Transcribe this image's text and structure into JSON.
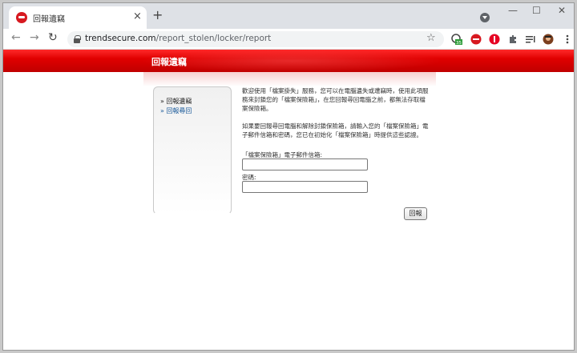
{
  "browser": {
    "tab_title": "回報遺竊",
    "tab_close": "×",
    "new_tab": "+",
    "minimize": "—",
    "maximize": "☐",
    "close_window": "✕",
    "back": "←",
    "forward": "→",
    "reload": "↻",
    "url_host": "trendsecure.com",
    "url_path": "/report_stolen/locker/report",
    "bookmark": "☆",
    "extensions": [
      {
        "name": "tracker-extension",
        "badge": "35"
      },
      {
        "name": "trend-micro-extension"
      },
      {
        "name": "pinterest-extension"
      },
      {
        "name": "extensions-puzzle"
      },
      {
        "name": "reading-list"
      },
      {
        "name": "profile-avatar"
      },
      {
        "name": "menu"
      }
    ]
  },
  "page": {
    "brand_title": "回報遺竊",
    "sidebar": {
      "items": [
        {
          "label": "回報遺竊",
          "current": true
        },
        {
          "label": "回報尋回",
          "current": false
        }
      ]
    },
    "intro_1": "歡迎使用「檔案掛失」服務，您可以在電腦遺失或遭竊時，使用此項服務來封鎖您的「檔案保險箱」，在您回報尋回電腦之前，都無法存取檔案保險箱。",
    "intro_2": "如果要回報尋回電腦和解除封鎖保險箱，請輸入您的「檔案保險箱」電子郵件信箱和密碼，您已在初始化「檔案保險箱」時提供這些認證。",
    "email_label": "「檔案保險箱」電子郵件信箱:",
    "email_value": "",
    "password_label": "密碼:",
    "password_value": "",
    "submit_label": "回報"
  },
  "colors": {
    "banner_red": "#e00000",
    "link_blue": "#1a5a9a"
  }
}
